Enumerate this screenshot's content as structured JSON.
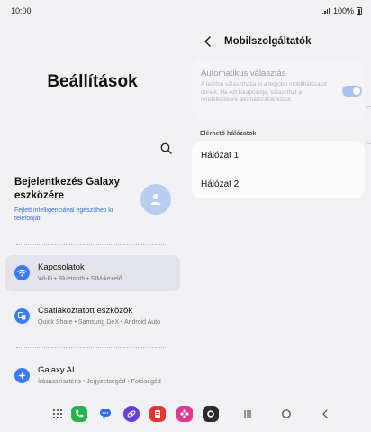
{
  "status_bar": {
    "time": "10:00",
    "battery": "100%"
  },
  "left_pane": {
    "title": "Beállítások",
    "account": {
      "title": "Bejelentkezés Galaxy eszközére",
      "subtitle": "Fejlett intelligenciával egészítheti ki telefonját."
    },
    "menu": [
      {
        "label": "Kapcsolatok",
        "sub": "Wi-Fi  •  Bluetooth  •  SIM-kezelő",
        "icon": "wifi-icon",
        "color": "#3a7bf6"
      },
      {
        "label": "Csatlakoztatott eszközök",
        "sub": "Quick Share  •  Samsung DeX  •  Android Auto",
        "icon": "connected-devices-icon",
        "color": "#3a7bf6"
      },
      {
        "label": "Galaxy AI",
        "sub": "Írásasszisztens  •  Jegyzetsegéd  •  Fotósegéd",
        "icon": "galaxy-ai-icon",
        "color": "#3a7bf6"
      }
    ]
  },
  "right_pane": {
    "title": "Mobilszolgáltatók",
    "auto_select": {
      "title": "Automatikus választás",
      "description": "A telefon választhatja ki a legjobb mobilhálózatot önnek. Ha ezt kikapcsolja, választhat a rendelkezésre álló hálózatok közül.",
      "enabled": true
    },
    "section_label": "Elérhető hálózatok",
    "networks": [
      "Hálózat 1",
      "Hálózat 2"
    ]
  },
  "colors": {
    "accent": "#3a7bf6",
    "link": "#3a6fd8",
    "toggle_disabled_on": "#a9c1ee"
  },
  "taskbar": {
    "apps": [
      "apps-grid-icon",
      "phone-icon",
      "messages-icon",
      "internet-icon",
      "office-icon",
      "gallery-icon",
      "camera-icon"
    ],
    "nav": [
      "recent-apps-icon",
      "home-icon",
      "back-icon"
    ]
  }
}
